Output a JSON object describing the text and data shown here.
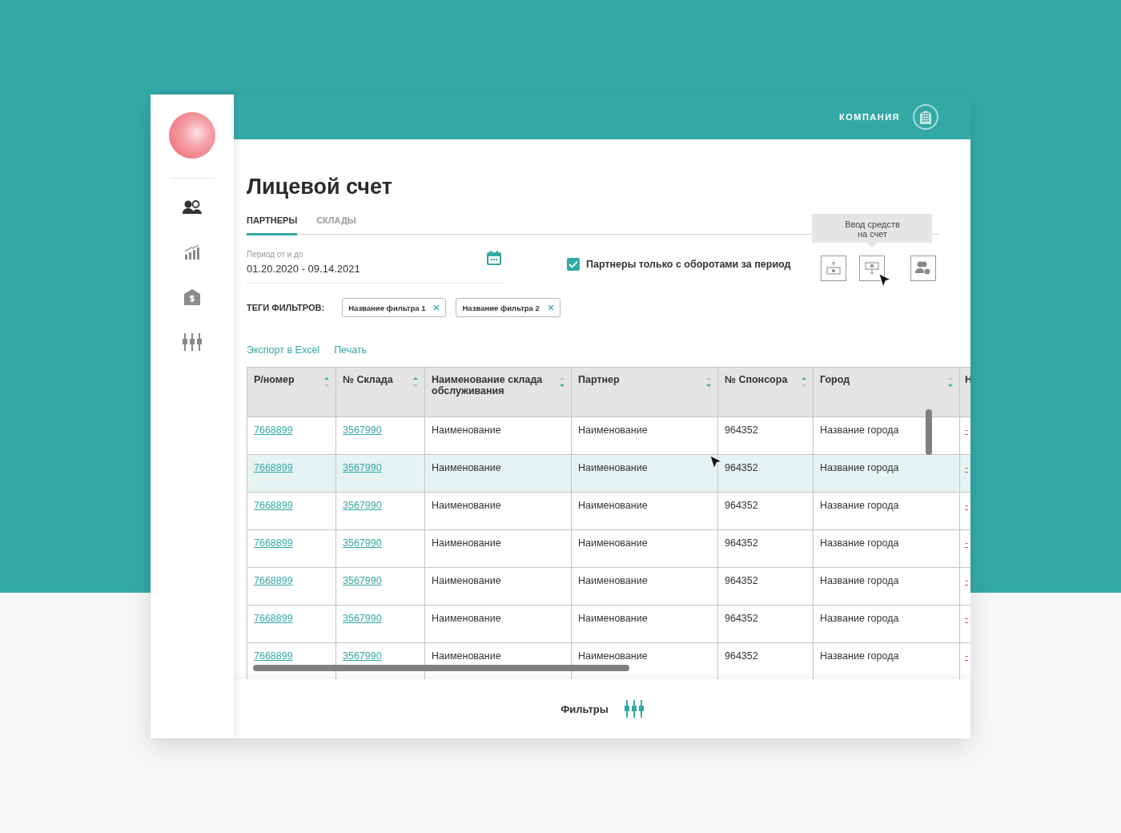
{
  "header": {
    "company": "КОМПАНИЯ"
  },
  "sidebar": {
    "items": [
      {
        "kind": "partners",
        "selected": true
      },
      {
        "kind": "stats",
        "selected": false
      },
      {
        "kind": "finance",
        "selected": false
      },
      {
        "kind": "filters",
        "selected": false
      }
    ]
  },
  "title": "Лицевой счет",
  "tabs": [
    {
      "label": "ПАРТНЕРЫ",
      "selected": true
    },
    {
      "label": "СКЛАДЫ",
      "selected": false
    }
  ],
  "period": {
    "label": "Период от и до",
    "value": "01.20.2020 - 09.14.2021"
  },
  "turnover_filter": {
    "label": "Партнеры только с оборотами за период",
    "checked": true
  },
  "actions": [
    {
      "kind": "withdraw"
    },
    {
      "kind": "deposit",
      "tooltip": "Ввод средств\nна счет"
    },
    {
      "kind": "partner_payment"
    }
  ],
  "filter_tags": {
    "label": "ТЕГИ ФИЛЬТРОВ:",
    "tags": [
      "Название фильтра 1",
      "Название фильтра 2"
    ]
  },
  "links": [
    "Экспорт в Excel",
    "Печать"
  ],
  "table": {
    "columns": [
      {
        "label": "Р/номер",
        "sort_ascending": true,
        "kind": "link"
      },
      {
        "label": "№ Склада",
        "sort_ascending": true,
        "kind": "link"
      },
      {
        "label": "Наименование склада обслуживания",
        "sort_ascending": false,
        "kind": "text"
      },
      {
        "label": "Партнер",
        "sort_ascending": false,
        "kind": "text"
      },
      {
        "label": "№ Спонсора",
        "sort_ascending": true,
        "kind": "text"
      },
      {
        "label": "Город",
        "sort_ascending": false,
        "kind": "text"
      },
      {
        "label": "Н",
        "kind": "alert_link"
      }
    ],
    "rows": [
      {
        "selected": false,
        "cells": [
          "7668899",
          "3567990",
          "Наименование",
          "Наименование",
          "964352",
          "Название города",
          "-"
        ]
      },
      {
        "selected": true,
        "cells": [
          "7668899",
          "3567990",
          "Наименование",
          "Наименование",
          "964352",
          "Название города",
          "-"
        ]
      },
      {
        "selected": false,
        "cells": [
          "7668899",
          "3567990",
          "Наименование",
          "Наименование",
          "964352",
          "Название города",
          "-"
        ]
      },
      {
        "selected": false,
        "cells": [
          "7668899",
          "3567990",
          "Наименование",
          "Наименование",
          "964352",
          "Название города",
          "-"
        ]
      },
      {
        "selected": false,
        "cells": [
          "7668899",
          "3567990",
          "Наименование",
          "Наименование",
          "964352",
          "Название города",
          "-"
        ]
      },
      {
        "selected": false,
        "cells": [
          "7668899",
          "3567990",
          "Наименование",
          "Наименование",
          "964352",
          "Название города",
          "-"
        ]
      },
      {
        "selected": false,
        "cells": [
          "7668899",
          "3567990",
          "Наименование",
          "Наименование",
          "964352",
          "Название города",
          "-"
        ]
      }
    ]
  },
  "footer": {
    "label": "Фильтры"
  }
}
